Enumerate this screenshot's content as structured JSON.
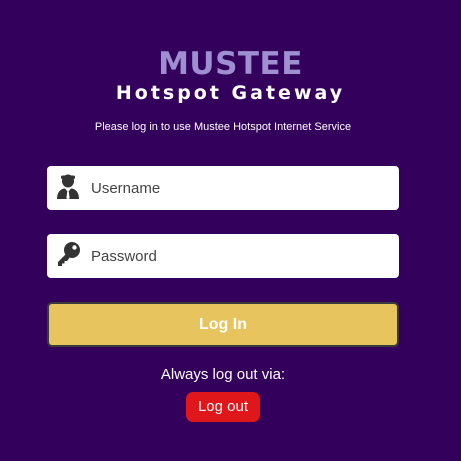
{
  "header": {
    "brand": "MUSTEE",
    "subtitle": "Hotspot Gateway",
    "tagline": "Please log in to use Mustee Hotspot Internet Service"
  },
  "form": {
    "username": {
      "placeholder": "Username",
      "value": "",
      "icon": "user-icon"
    },
    "password": {
      "placeholder": "Password",
      "value": "",
      "icon": "key-icon"
    },
    "login_label": "Log In"
  },
  "logout": {
    "label": "Always log out via:",
    "button_label": "Log out"
  },
  "colors": {
    "background": "#33005c",
    "brand": "#9e8fd0",
    "login_button": "#e8c45e",
    "logout_button": "#e0171a"
  }
}
